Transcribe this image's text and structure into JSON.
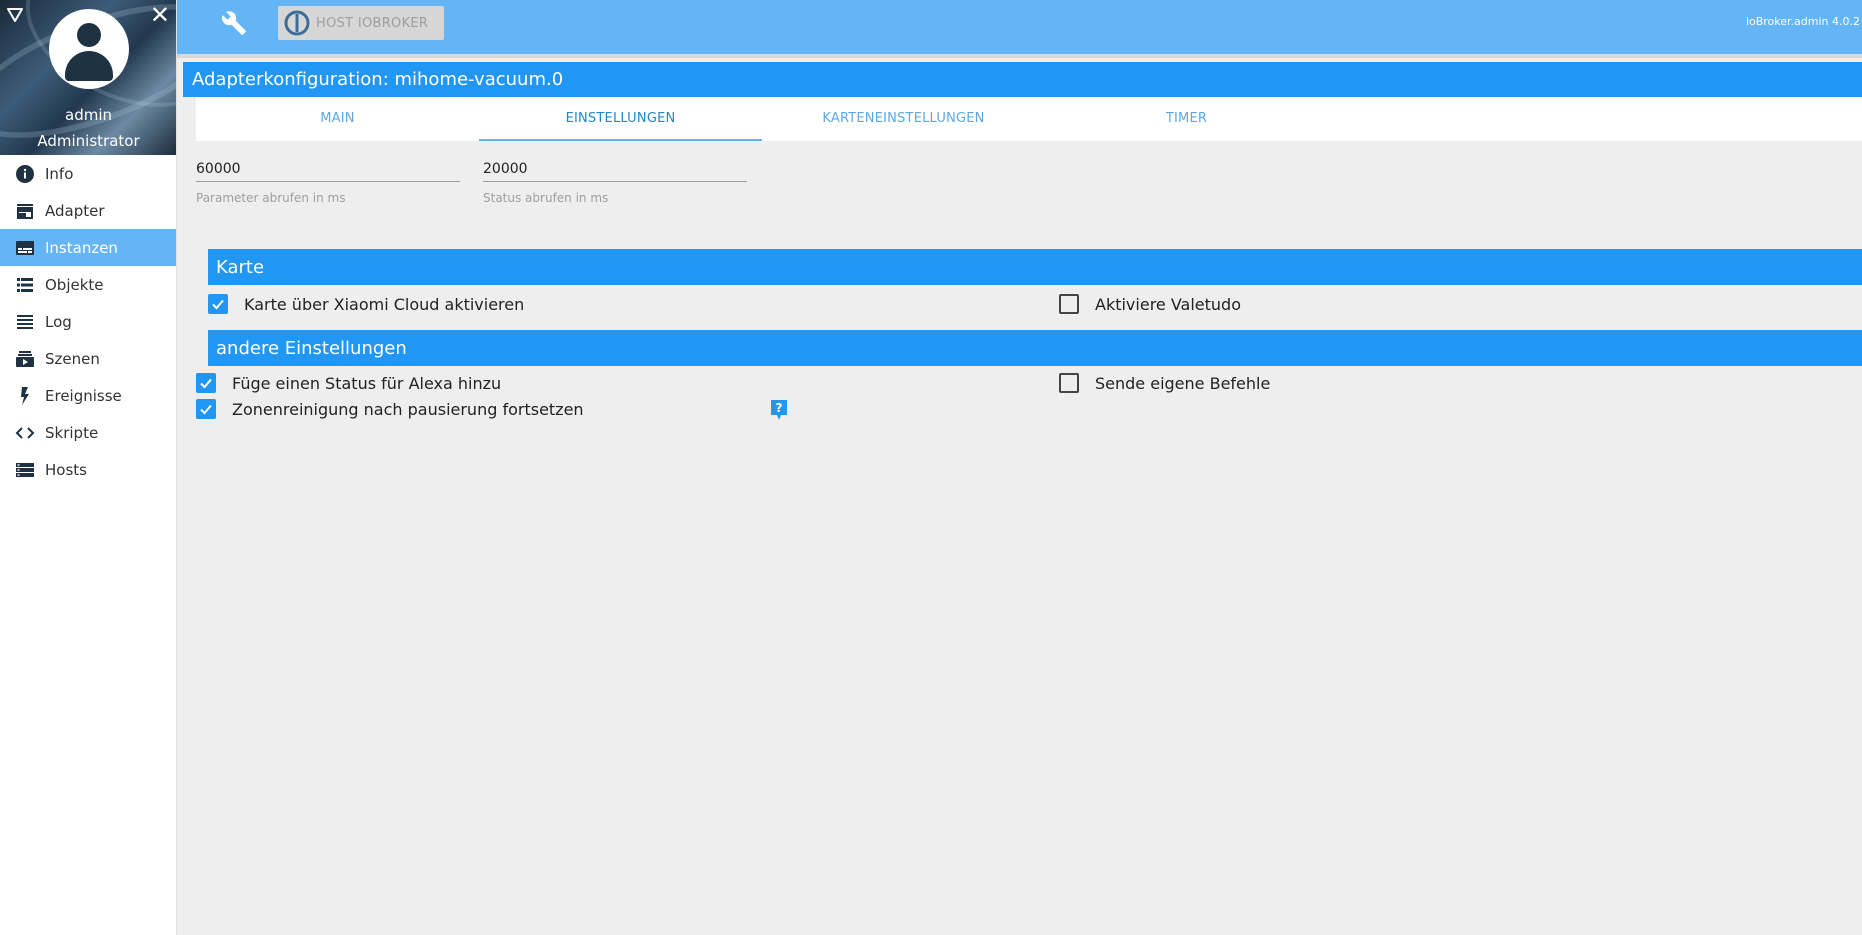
{
  "sidebar": {
    "user": {
      "name": "admin",
      "role": "Administrator"
    },
    "items": [
      {
        "label": "Info",
        "icon": "info-icon",
        "active": false
      },
      {
        "label": "Adapter",
        "icon": "store-icon",
        "active": false
      },
      {
        "label": "Instanzen",
        "icon": "subtitles-icon",
        "active": true
      },
      {
        "label": "Objekte",
        "icon": "list-icon",
        "active": false
      },
      {
        "label": "Log",
        "icon": "lines-icon",
        "active": false
      },
      {
        "label": "Szenen",
        "icon": "slideshow-icon",
        "active": false
      },
      {
        "label": "Ereignisse",
        "icon": "flash-icon",
        "active": false
      },
      {
        "label": "Skripte",
        "icon": "code-icon",
        "active": false
      },
      {
        "label": "Hosts",
        "icon": "storage-icon",
        "active": false
      }
    ]
  },
  "topbar": {
    "host_button": "HOST IOBROKER",
    "version": "ioBroker.admin 4.0.2"
  },
  "config": {
    "title": "Adapterkonfiguration: mihome-vacuum.0",
    "tabs": [
      {
        "label": "MAIN",
        "active": false
      },
      {
        "label": "EINSTELLUNGEN",
        "active": true
      },
      {
        "label": "KARTENEINSTELLUNGEN",
        "active": false
      },
      {
        "label": "TIMER",
        "active": false
      }
    ],
    "fields": [
      {
        "value": "60000",
        "label": "Parameter abrufen in ms"
      },
      {
        "value": "20000",
        "label": "Status abrufen in ms"
      }
    ],
    "sections": [
      {
        "title": "Karte",
        "options": [
          {
            "label": "Karte über Xiaomi Cloud aktivieren",
            "checked": true
          },
          {
            "label": "Aktiviere Valetudo",
            "checked": false
          }
        ]
      },
      {
        "title": "andere Einstellungen",
        "options": [
          {
            "label": "Füge einen Status für Alexa hinzu",
            "checked": true
          },
          {
            "label": "Sende eigene Befehle",
            "checked": false
          },
          {
            "label": "Zonenreinigung nach pausierung fortsetzen",
            "checked": true
          }
        ]
      }
    ]
  },
  "colors": {
    "primary": "#2196f3",
    "topbar": "#64b5f6",
    "active_nav": "#64b5f6",
    "background": "#eeeeee"
  }
}
